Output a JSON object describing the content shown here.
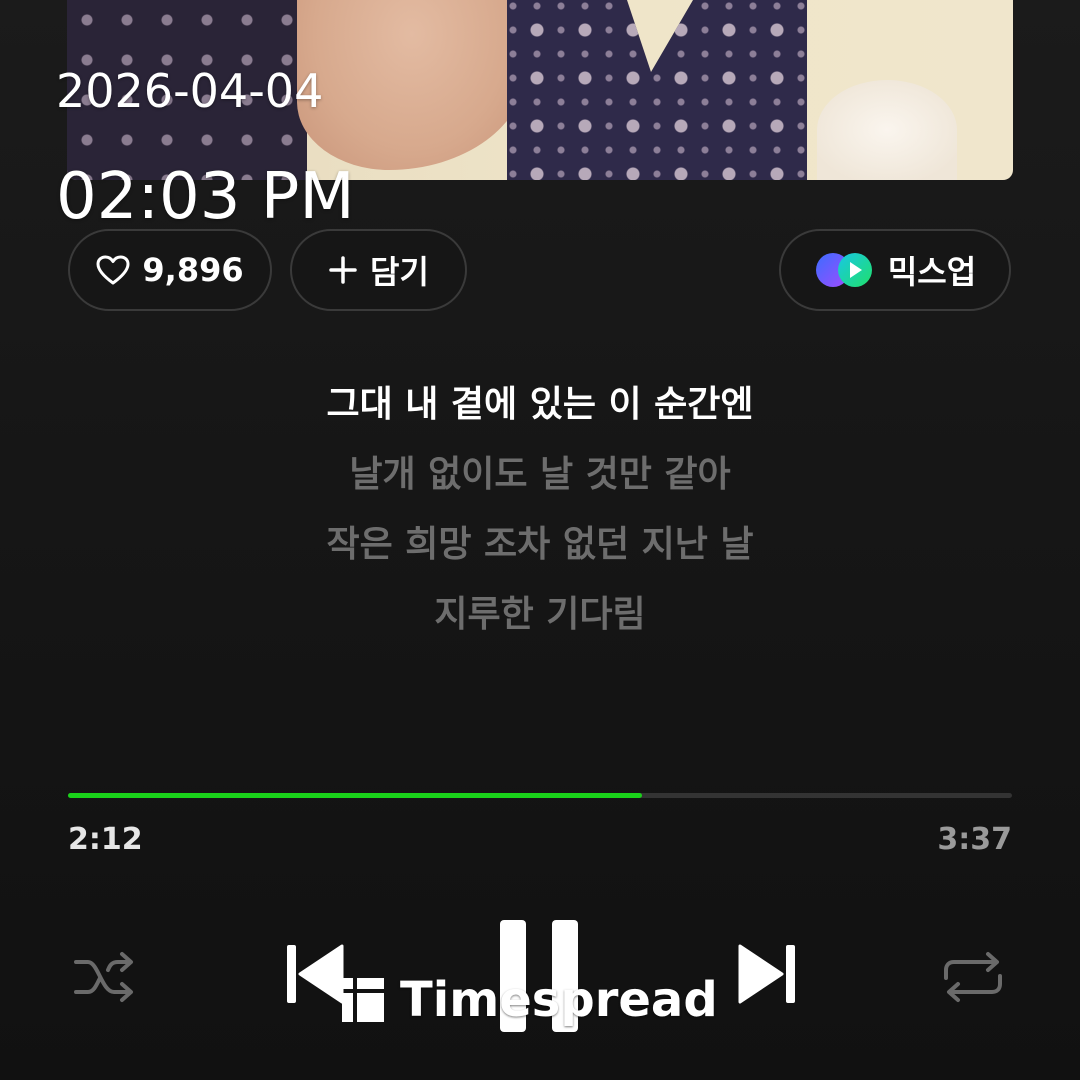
{
  "overlay": {
    "date": "2026-04-04",
    "time": "02:03 PM"
  },
  "actions": {
    "like_count": "9,896",
    "add_label": "담기",
    "mixup_label": "믹스업"
  },
  "lyrics": [
    {
      "text": "그대 내 곁에 있는 이 순간엔",
      "current": true
    },
    {
      "text": "날개 없이도 날 것만 같아",
      "current": false
    },
    {
      "text": "작은 희망 조차 없던 지난 날",
      "current": false
    },
    {
      "text": "지루한 기다림",
      "current": false
    }
  ],
  "playback": {
    "elapsed": "2:12",
    "total": "3:37",
    "progress_fraction": 0.608,
    "accent_color": "#1ad21a"
  },
  "controls": {
    "shuffle_icon": "shuffle-icon",
    "prev_icon": "skip-previous-icon",
    "pause_icon": "pause-icon",
    "next_icon": "skip-next-icon",
    "repeat_icon": "repeat-icon"
  },
  "watermark": {
    "text": "Timespread"
  }
}
